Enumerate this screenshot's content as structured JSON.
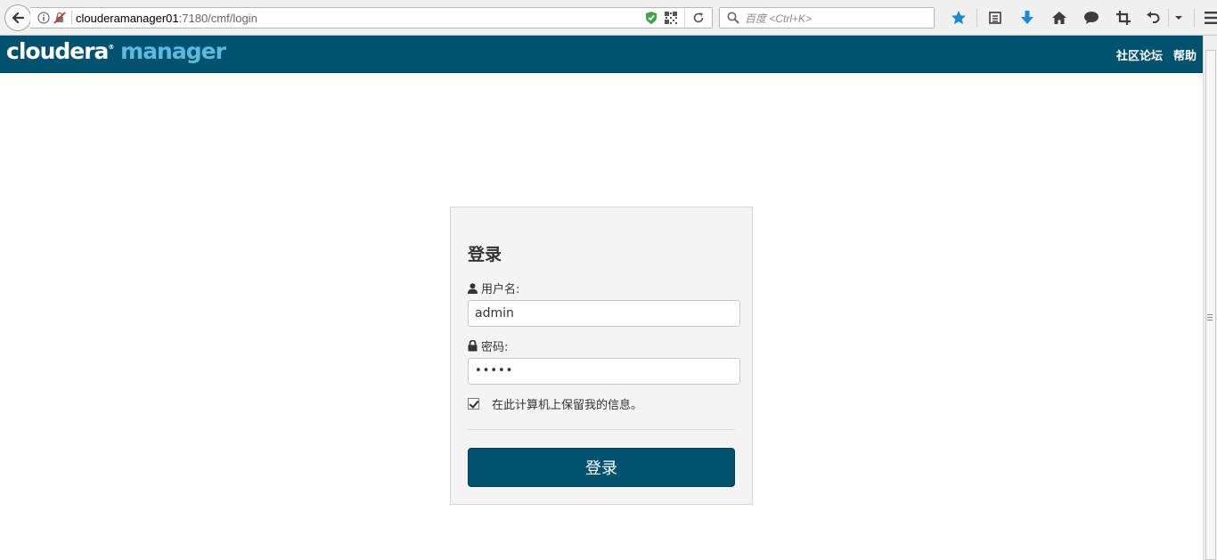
{
  "browser": {
    "url_host": "clouderamanager01",
    "url_path": ":7180/cmf/login",
    "search_placeholder": "百度 <Ctrl+K>"
  },
  "header": {
    "logo_part1": "cloudera",
    "logo_part2": "manager",
    "links": [
      "社区论坛",
      "帮助"
    ]
  },
  "login": {
    "title": "登录",
    "username_label": "用户名:",
    "username_value": "admin",
    "password_label": "密码:",
    "password_value": "•••••",
    "remember_label": "在此计算机上保留我的信息。",
    "remember_checked": true,
    "submit_label": "登录"
  },
  "colors": {
    "header_bg": "#02526f",
    "logo_accent": "#5fb8dd",
    "button_bg": "#02526f"
  }
}
